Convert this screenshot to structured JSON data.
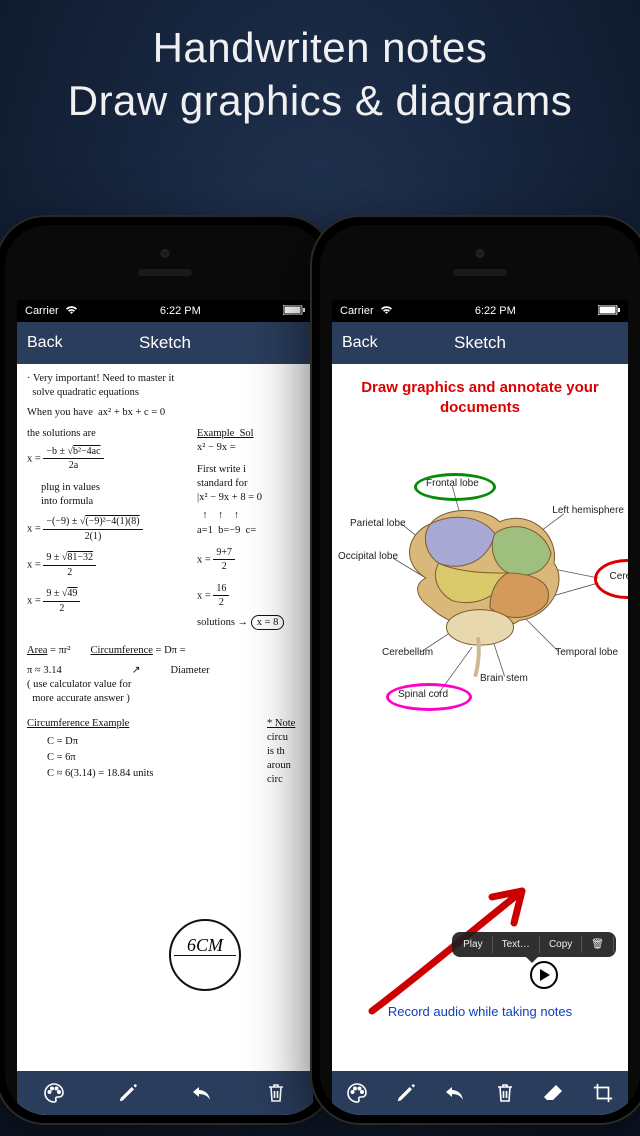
{
  "headline": {
    "line1": "Handwriten notes",
    "line2": "Draw graphics & diagrams"
  },
  "status": {
    "carrier": "Carrier",
    "time": "6:22 PM"
  },
  "nav": {
    "back": "Back",
    "title": "Sketch"
  },
  "toolbar_left": {
    "items": [
      "palette-icon",
      "pencil-icon",
      "undo-icon",
      "trash-icon"
    ]
  },
  "toolbar_right": {
    "items": [
      "palette-icon",
      "pencil-icon",
      "undo-icon",
      "trash-icon",
      "eraser-icon",
      "crop-icon"
    ]
  },
  "sketch_left": {
    "line1": "· Very important! Need to master it",
    "line2": "  solve quadratic equations",
    "line3": "When you have  ax² + bx + c = 0",
    "line4": "the solutions are",
    "example_heading": "Example  Sol",
    "example_eq": "x² − 9x =",
    "plug": "plug in values\ninto formula",
    "first_write": "First write i\nstandard for\n|x² − 9x + 8 = 0",
    "coeff": "a=1  b=−9  c=",
    "step2_rhs": "x = 9+7\n    ─\n    2",
    "step3_lhs": "x = 9 ± √49\n    ───\n     2",
    "step3_rhs": "x = 16\n    ─\n    2",
    "solutions": "solutions →",
    "solutions_val": "x = 8",
    "area_label": "Area",
    "area_formula": "= πr²",
    "circ_label": "Circumference",
    "circ_formula": "= Dπ =",
    "pi": "π ≈ 3.14",
    "diameter": "Diameter",
    "note": "( use calculator value for\n  more accurate answer )",
    "circumference_example": "Circumference Example",
    "star_note": "* Note",
    "circ_note_body": "circu\nis th\naroun\ncirc",
    "ex_line1": "C = Dπ",
    "ex_line2": "C = 6π",
    "ex_line3": "C ≈ 6(3.14) = 18.84 units",
    "circle_measure": "6CM"
  },
  "sketch_right": {
    "doc_title": "Draw graphics and annotate your documents",
    "labels": {
      "frontal": "Frontal lobe",
      "parietal": "Parietal lobe",
      "occipital": "Occipital lobe",
      "left_hemisphere": "Left hemisphere",
      "cerebrum": "Cerebrum",
      "temporal": "Temporal lobe",
      "cerebellum": "Cerebellum",
      "brain_stem": "Brain stem",
      "spinal_cord": "Spinal cord"
    },
    "context_menu": {
      "play": "Play",
      "text": "Text…",
      "copy": "Copy",
      "trash": "🗑"
    },
    "audio_caption": "Record audio while taking notes"
  }
}
